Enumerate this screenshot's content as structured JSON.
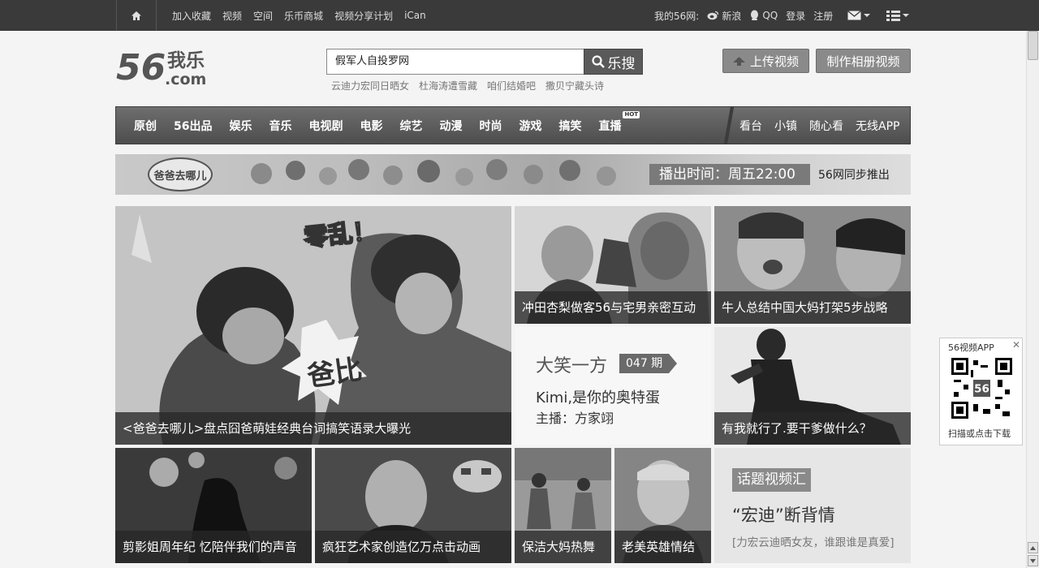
{
  "topbar": {
    "home_icon": "home-icon",
    "links": [
      "加入收藏",
      "视频",
      "空间",
      "乐币商城",
      "视频分享计划",
      "iCan"
    ],
    "my56": "我的56网:",
    "sina": "新浪",
    "qq": "QQ",
    "login": "登录",
    "register": "注册",
    "mail_icon": "mail-icon",
    "menu_icon": "grid-menu-icon"
  },
  "logo": {
    "number": "56",
    "cn": "我乐",
    "domain": ".com"
  },
  "search": {
    "value": "假军人自投罗网",
    "button_label": "乐搜",
    "hot_words": [
      "云迪力宏同日晒女",
      "杜海涛遭雪藏",
      "咱们结婚吧",
      "撒贝宁藏头诗"
    ]
  },
  "actions": {
    "upload": "上传视频",
    "album": "制作相册视频"
  },
  "nav": {
    "categories": [
      "原创",
      "56出品",
      "娱乐",
      "音乐",
      "电视剧",
      "电影",
      "综艺",
      "动漫",
      "时尚",
      "游戏",
      "搞笑",
      "直播"
    ],
    "hot_badge": "HOT",
    "secondary": [
      "看台",
      "小镇",
      "随心看",
      "无线APP"
    ]
  },
  "banner": {
    "show_name": "爸爸去哪儿",
    "airtime": "播出时间：周五22:00",
    "sync": "56网同步推出"
  },
  "tiles": {
    "big": {
      "caption": "<爸爸去哪儿>盘点囧爸萌娃经典台词搞笑语录大曝光",
      "overlay1": "零乱！",
      "overlay2": "爸比"
    },
    "t1": {
      "caption": "冲田杏梨做客56与宅男亲密互动"
    },
    "t2": {
      "caption": "牛人总结中国大妈打架5步战略"
    },
    "t3": {
      "caption": "有我就行了.要干爹做什么？"
    },
    "b1": {
      "caption": "剪影姐周年纪 忆陪伴我们的声音"
    },
    "b2": {
      "caption": "疯狂艺术家创造亿万点击动画"
    },
    "b3": {
      "caption": "保洁大妈热舞"
    },
    "b4": {
      "caption": "老美英雄情结"
    }
  },
  "laugh": {
    "title": "大笑一方",
    "issue": "047 期",
    "line1": "Kimi,是你的奥特蛋",
    "line2": "主播：方家翊"
  },
  "topic": {
    "tag": "话题视频汇",
    "headline": "“宏迪”断背情",
    "desc": "[力宏云迪晒女友，谁跟谁是真爱]"
  },
  "app": {
    "title": "56视频APP",
    "close": "✕",
    "bottom": "扫描或点击下载",
    "qr_label": "56"
  }
}
